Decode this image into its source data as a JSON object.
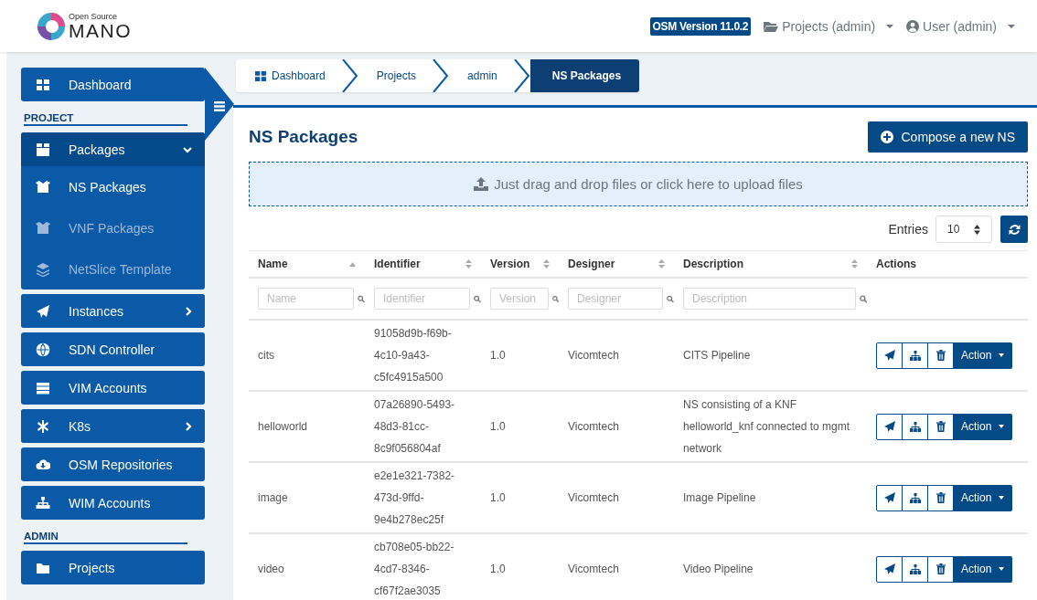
{
  "header": {
    "logo": {
      "small": "Open Source",
      "large": "MANO"
    },
    "version_badge": "OSM Version 11.0.2",
    "projects_menu": "Projects (admin)",
    "user_menu": "User (admin)"
  },
  "sidebar": {
    "items": [
      {
        "kind": "link",
        "label": "Dashboard"
      },
      {
        "kind": "heading",
        "label": "PROJECT"
      },
      {
        "kind": "menu",
        "label": "Packages",
        "expanded": true,
        "children": [
          {
            "label": "NS Packages",
            "selected": true
          },
          {
            "label": "VNF Packages",
            "selected": false
          },
          {
            "label": "NetSlice Template",
            "selected": false
          }
        ]
      },
      {
        "kind": "menu",
        "label": "Instances",
        "expanded": false
      },
      {
        "kind": "link",
        "label": "SDN Controller"
      },
      {
        "kind": "link",
        "label": "VIM Accounts"
      },
      {
        "kind": "menu",
        "label": "K8s",
        "expanded": false
      },
      {
        "kind": "link",
        "label": "OSM Repositories"
      },
      {
        "kind": "link",
        "label": "WIM Accounts"
      },
      {
        "kind": "heading",
        "label": "ADMIN"
      },
      {
        "kind": "link",
        "label": "Projects"
      }
    ]
  },
  "breadcrumb": [
    {
      "label": "Dashboard",
      "selected": false
    },
    {
      "label": "Projects",
      "selected": false
    },
    {
      "label": "admin",
      "selected": false
    },
    {
      "label": "NS Packages",
      "selected": true
    }
  ],
  "page": {
    "title": "NS Packages",
    "compose_button": "Compose a new NS",
    "dropzone": "Just drag and drop files or click here to upload files",
    "entries_label": "Entries",
    "entries_value": "10"
  },
  "table": {
    "columns": [
      {
        "label": "Name",
        "sorted": true,
        "filter_placeholder": "Name"
      },
      {
        "label": "Identifier",
        "sorted": false,
        "filter_placeholder": "Identifier"
      },
      {
        "label": "Version",
        "sorted": false,
        "filter_placeholder": "Version"
      },
      {
        "label": "Designer",
        "sorted": false,
        "filter_placeholder": "Designer"
      },
      {
        "label": "Description",
        "sorted": false,
        "filter_placeholder": "Description"
      },
      {
        "label": "Actions"
      }
    ],
    "rows": [
      {
        "name": "cits",
        "identifier": "91058d9b-f69b-4c10-9a43-c5fc4915a500",
        "version": "1.0",
        "designer": "Vicomtech",
        "description": "CITS Pipeline",
        "action": "Action"
      },
      {
        "name": "helloworld",
        "identifier": "07a26890-5493-48d3-81cc-8c9f056804af",
        "version": "1.0",
        "designer": "Vicomtech",
        "description": "NS consisting of a KNF helloworld_knf connected to mgmt network",
        "action": "Action"
      },
      {
        "name": "image",
        "identifier": "e2e1e321-7382-473d-9ffd-9e4b278ec25f",
        "version": "1.0",
        "designer": "Vicomtech",
        "description": "Image Pipeline",
        "action": "Action"
      },
      {
        "name": "video",
        "identifier": "cb708e05-bb22-4cd7-8346-cf67f2ae3035",
        "version": "1.0",
        "designer": "Vicomtech",
        "description": "Video Pipeline",
        "action": "Action"
      }
    ]
  }
}
